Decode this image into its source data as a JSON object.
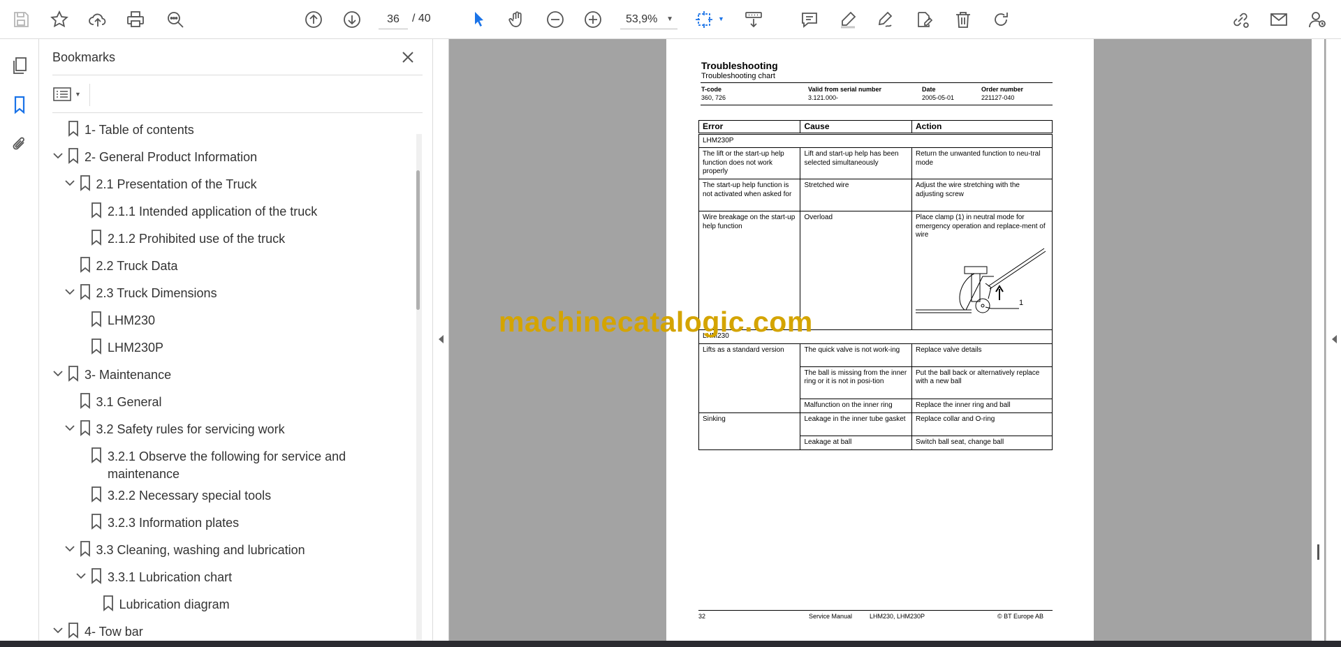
{
  "toolbar": {
    "current_page": "36",
    "total_pages": "/ 40",
    "zoom": "53,9%"
  },
  "bookmarks": {
    "title": "Bookmarks",
    "items": [
      {
        "label": "1- Table of contents",
        "level": 0,
        "expandable": false
      },
      {
        "label": "2- General Product Information",
        "level": 0,
        "expandable": true
      },
      {
        "label": "2.1 Presentation of the Truck",
        "level": 1,
        "expandable": true
      },
      {
        "label": "2.1.1 Intended application of the truck",
        "level": 2,
        "expandable": false
      },
      {
        "label": "2.1.2 Prohibited use of the truck",
        "level": 2,
        "expandable": false
      },
      {
        "label": "2.2 Truck Data",
        "level": 1,
        "expandable": false
      },
      {
        "label": "2.3 Truck Dimensions",
        "level": 1,
        "expandable": true
      },
      {
        "label": "LHM230",
        "level": 2,
        "expandable": false
      },
      {
        "label": "LHM230P",
        "level": 2,
        "expandable": false
      },
      {
        "label": "3- Maintenance",
        "level": 0,
        "expandable": true
      },
      {
        "label": "3.1 General",
        "level": 1,
        "expandable": false
      },
      {
        "label": "3.2 Safety rules for servicing work",
        "level": 1,
        "expandable": true
      },
      {
        "label": "3.2.1 Observe the following for service and maintenance",
        "level": 2,
        "expandable": false
      },
      {
        "label": "3.2.2 Necessary special tools",
        "level": 2,
        "expandable": false
      },
      {
        "label": "3.2.3 Information plates",
        "level": 2,
        "expandable": false
      },
      {
        "label": "3.3 Cleaning, washing and lubrication",
        "level": 1,
        "expandable": true
      },
      {
        "label": "3.3.1 Lubrication chart",
        "level": 2,
        "expandable": true
      },
      {
        "label": "Lubrication diagram",
        "level": 3,
        "expandable": false
      },
      {
        "label": "4- Tow bar",
        "level": 0,
        "expandable": true
      }
    ]
  },
  "document": {
    "title": "Troubleshooting",
    "subtitle": "Troubleshooting chart",
    "meta": {
      "tcode_label": "T-code",
      "tcode": "360, 726",
      "serial_label": "Valid from serial number",
      "serial": "3.121.000-",
      "date_label": "Date",
      "date": "2005-05-01",
      "order_label": "Order number",
      "order": "221127-040"
    },
    "table": {
      "headers": [
        "Error",
        "Cause",
        "Action"
      ],
      "section1": "LHM230P",
      "rows1": [
        [
          "The lift or the start-up help function does not work properly",
          "Lift and start-up help has been selected simultaneously",
          "Return the unwanted function to neu-tral mode"
        ],
        [
          "The start-up help function is not activated when asked for",
          "Stretched wire",
          "Adjust the wire stretching with the adjusting screw"
        ],
        [
          "Wire breakage on the start-up help function",
          "Overload",
          "Place clamp (1) in neutral mode for emergency operation and replace-ment of wire"
        ]
      ],
      "figure_callout": "1",
      "section2": "LHM230",
      "lifts_error": "Lifts as a standard version",
      "lifts_rows": [
        [
          "The quick valve is not work-ing",
          "Replace valve details"
        ],
        [
          "The ball is missing from the inner ring or it is not in posi-tion",
          "Put the ball back or alternatively replace with a new ball"
        ],
        [
          "Malfunction on the inner ring",
          "Replace the inner ring and ball"
        ]
      ],
      "sinking_error": "Sinking",
      "sinking_rows": [
        [
          "Leakage in the inner tube gasket",
          "Replace collar and O-ring"
        ],
        [
          "Leakage at ball",
          "Switch ball seat, change ball"
        ]
      ]
    },
    "footer": {
      "page": "32",
      "manual": "Service Manual",
      "models": "LHM230, LHM230P",
      "copyright": "© BT Europe AB"
    }
  },
  "watermark": "machinecatalogic.com",
  "colors": {
    "accent": "#1a73e8",
    "icon": "#555555",
    "viewport_bg": "#a3a3a3",
    "watermark": "#d4a400"
  }
}
